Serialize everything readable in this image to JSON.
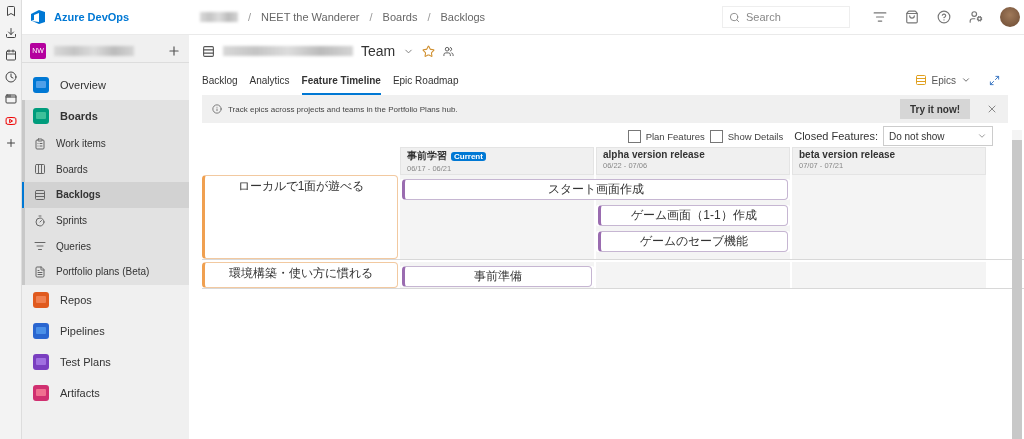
{
  "browser_toolbar": {
    "items": [
      {
        "kind": "bookmark"
      },
      {
        "kind": "download"
      },
      {
        "kind": "calendar"
      },
      {
        "kind": "history"
      },
      {
        "kind": "window"
      },
      {
        "kind": "video"
      },
      {
        "kind": "add"
      }
    ]
  },
  "header": {
    "brand": "Azure DevOps",
    "breadcrumb": [
      {
        "kind": "blurred"
      },
      {
        "kind": "separator",
        "label": "/"
      },
      {
        "kind": "text",
        "label": "NEET the Wanderer"
      },
      {
        "kind": "separator",
        "label": "/"
      },
      {
        "kind": "text",
        "label": "Boards"
      },
      {
        "kind": "separator",
        "label": "/"
      },
      {
        "kind": "text",
        "label": "Backlogs"
      }
    ],
    "search": {
      "placeholder": "Search"
    }
  },
  "sidebar": {
    "project": {
      "initials": "NW"
    },
    "hubs": [
      {
        "label": "Overview",
        "selected": false
      },
      {
        "label": "Boards",
        "selected": true,
        "children": [
          {
            "label": "Work items",
            "selected": false
          },
          {
            "label": "Boards",
            "selected": false
          },
          {
            "label": "Backlogs",
            "selected": true
          },
          {
            "label": "Sprints",
            "selected": false
          },
          {
            "label": "Queries",
            "selected": false
          },
          {
            "label": "Portfolio plans (Beta)",
            "selected": false
          }
        ]
      },
      {
        "label": "Repos",
        "selected": false
      },
      {
        "label": "Pipelines",
        "selected": false
      },
      {
        "label": "Test Plans",
        "selected": false
      },
      {
        "label": "Artifacts",
        "selected": false
      }
    ]
  },
  "team": {
    "name_suffix": "Team"
  },
  "tabs": [
    {
      "label": "Backlog",
      "selected": false
    },
    {
      "label": "Analytics",
      "selected": false
    },
    {
      "label": "Feature Timeline",
      "selected": true
    },
    {
      "label": "Epic Roadmap",
      "selected": false
    }
  ],
  "level_picker": {
    "label": "Epics"
  },
  "banner": {
    "text": "Track epics across projects and teams in the Portfolio Plans hub.",
    "button": "Try it now!"
  },
  "options": {
    "plan_features": {
      "label": "Plan Features",
      "checked": false
    },
    "show_details": {
      "label": "Show Details",
      "checked": false
    },
    "closed_features": {
      "label": "Closed Features:",
      "value": "Do not show"
    }
  },
  "iterations": [
    {
      "name": "事前学習",
      "badge": "Current",
      "dates": "06/17 - 06/21"
    },
    {
      "name": "alpha version release",
      "dates": "06/22 - 07/06"
    },
    {
      "name": "beta version release",
      "dates": "07/07 - 07/21"
    }
  ],
  "epics": [
    {
      "title": "ローカルで1面が遊べる",
      "features": [
        {
          "title": "スタート画面作成",
          "in_iteration": [
            true,
            true,
            false
          ]
        },
        {
          "title": "ゲーム画面（1-1）作成",
          "in_iteration": [
            false,
            true,
            false
          ]
        },
        {
          "title": "ゲームのセーブ機能",
          "in_iteration": [
            false,
            true,
            false
          ]
        }
      ]
    },
    {
      "title": "環境構築・使い方に慣れる",
      "features": [
        {
          "title": "事前準備",
          "in_iteration": [
            true,
            false,
            false
          ]
        }
      ]
    }
  ]
}
